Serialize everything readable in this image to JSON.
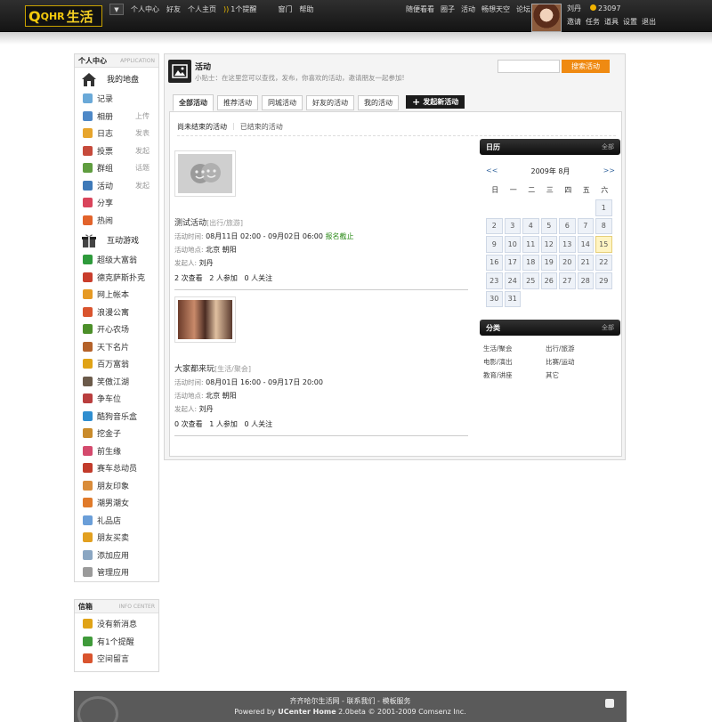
{
  "logo": {
    "q": "Q",
    "mid": "QHR",
    "cn": "生活"
  },
  "topnav": {
    "menu_arrow": "▼",
    "links": [
      "个人中心",
      "好友",
      "个人主页"
    ],
    "notify": "1个提醒",
    "links2": [
      "窗门",
      "帮助"
    ]
  },
  "rightnav": [
    "随便看看",
    "圈子",
    "活动",
    "畅想天空",
    "论坛"
  ],
  "user": {
    "name": "刘丹",
    "credits": "23097",
    "actions": [
      "邀请",
      "任务",
      "道具",
      "设置",
      "退出"
    ]
  },
  "sidebar": {
    "title": "个人中心",
    "title_en": "APPLICATION",
    "my_title": "我的地盘",
    "my_items": [
      {
        "label": "记录",
        "sub": "",
        "color": "#6aa9d8"
      },
      {
        "label": "相册",
        "sub": "上传",
        "color": "#4e88c7"
      },
      {
        "label": "日志",
        "sub": "发表",
        "color": "#e7a52d"
      },
      {
        "label": "投票",
        "sub": "发起",
        "color": "#c64a3b"
      },
      {
        "label": "群组",
        "sub": "话题",
        "color": "#5f9d3f"
      },
      {
        "label": "活动",
        "sub": "发起",
        "color": "#3e79b8"
      },
      {
        "label": "分享",
        "sub": "",
        "color": "#d9445b"
      },
      {
        "label": "热闹",
        "sub": "",
        "color": "#e2632b"
      }
    ],
    "games_title": "互动游戏",
    "games": [
      {
        "label": "超级大富翁",
        "color": "#2e9a3b"
      },
      {
        "label": "德克萨斯扑克",
        "color": "#c93d2c"
      },
      {
        "label": "网上帐本",
        "color": "#e69a24"
      },
      {
        "label": "浪漫公寓",
        "color": "#d9542e"
      },
      {
        "label": "开心农场",
        "color": "#4c8f2a"
      },
      {
        "label": "天下名片",
        "color": "#b4622a"
      },
      {
        "label": "百万富翁",
        "color": "#e0a316"
      },
      {
        "label": "笑傲江湖",
        "color": "#6b5a4a"
      },
      {
        "label": "争车位",
        "color": "#b93e3e"
      },
      {
        "label": "酷狗音乐盒",
        "color": "#2f8ed0"
      },
      {
        "label": "挖金子",
        "color": "#c98b2b"
      },
      {
        "label": "前生缘",
        "color": "#d44a6d"
      },
      {
        "label": "赛车总动员",
        "color": "#c23b2b"
      },
      {
        "label": "朋友印象",
        "color": "#d98c3a"
      },
      {
        "label": "潮男潮女",
        "color": "#e07a2a"
      },
      {
        "label": "礼品店",
        "color": "#6a9ed8"
      },
      {
        "label": "朋友买卖",
        "color": "#e2a020"
      },
      {
        "label": "添加应用",
        "color": "#8aa6c2"
      },
      {
        "label": "管理应用",
        "color": "#9a9a9a"
      }
    ]
  },
  "inbox": {
    "title": "信箱",
    "title_en": "INFO CENTER",
    "items": [
      {
        "label": "没有新消息",
        "color": "#e0a316"
      },
      {
        "label": "有1个提醒",
        "color": "#3f9a3a"
      },
      {
        "label": "空间留言",
        "color": "#d9542e"
      }
    ]
  },
  "main": {
    "title": "活动",
    "tip": "小贴士：在这里您可以查找，发布，你喜欢的活动，邀请朋友一起参加!",
    "search_placeholder": "",
    "search_button": "搜索活动",
    "tabs": [
      "全部活动",
      "推荐活动",
      "同城活动",
      "好友的活动",
      "我的活动"
    ],
    "new_button": "发起新活动",
    "subtabs": [
      "尚未结束的活动",
      "已结束的活动"
    ],
    "events": [
      {
        "title": "测试活动",
        "category": "[出行/旅游]",
        "time_label": "活动时间:",
        "time": "08月11日 02:00 - 09月02日 06:00",
        "status": "报名截止",
        "place_label": "活动地点:",
        "place": "北京 朝阳",
        "host_label": "发起人:",
        "host": "刘丹",
        "stats": "2 次查看   2 人参加   0 人关注"
      },
      {
        "title": "大家都来玩",
        "category": "[生活/聚会]",
        "time_label": "活动时间:",
        "time": "08月01日 16:00 - 09月17日 20:00",
        "status": "",
        "place_label": "活动地点:",
        "place": "北京 朝阳",
        "host_label": "发起人:",
        "host": "刘丹",
        "stats": "0 次查看   1 人参加   0 人关注"
      }
    ]
  },
  "calendar": {
    "title": "日历",
    "all": "全部",
    "prev": "<<",
    "month": "2009年  8月",
    "next": ">>",
    "weekdays": [
      "日",
      "一",
      "二",
      "三",
      "四",
      "五",
      "六"
    ],
    "leading_blanks": 6,
    "days": 31,
    "today": 15
  },
  "categories": {
    "title": "分类",
    "all": "全部",
    "items": [
      "生活/聚会",
      "出行/旅游",
      "电影/演出",
      "比赛/运动",
      "教育/讲座",
      "其它"
    ]
  },
  "footer": {
    "line1": "齐齐哈尔生活网 - 联系我们 - 模板服务",
    "powered_prefix": "Powered by ",
    "powered_product": "UCenter Home",
    "powered_suffix": " 2.0beta © 2001-2009 Comsenz Inc."
  }
}
